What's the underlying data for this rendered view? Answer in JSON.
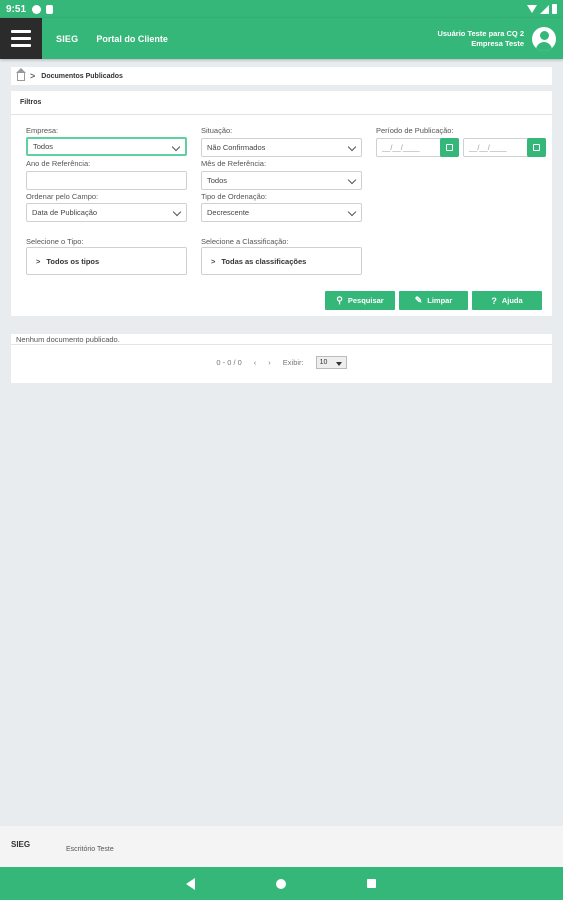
{
  "statusbar": {
    "time": "9:51"
  },
  "appbar": {
    "logo": "SIEG",
    "title": "Portal do Cliente",
    "user_name": "Usuário Teste para CQ 2",
    "company": "Empresa Teste"
  },
  "breadcrumb": {
    "current": "Documentos Publicados"
  },
  "filters": {
    "title": "Filtros",
    "empresa": {
      "label": "Empresa:",
      "value": "Todos"
    },
    "situacao": {
      "label": "Situação:",
      "value": "Não Confirmados"
    },
    "periodo": {
      "label": "Período de Publicação:",
      "start_placeholder": "__/__/____",
      "end_placeholder": "__/__/____"
    },
    "ano": {
      "label": "Ano de Referência:",
      "value": ""
    },
    "mes": {
      "label": "Mês de Referência:",
      "value": "Todos"
    },
    "ordenar": {
      "label": "Ordenar pelo Campo:",
      "value": "Data de Publicação"
    },
    "tipo_ordenacao": {
      "label": "Tipo de Ordenação:",
      "value": "Decrescente"
    },
    "tipo": {
      "label": "Selecione o Tipo:",
      "value": "Todos os tipos"
    },
    "classificacao": {
      "label": "Selecione a Classificação:",
      "value": "Todas as classificações"
    },
    "buttons": {
      "search": "Pesquisar",
      "clear": "Limpar",
      "help": "Ajuda"
    }
  },
  "results": {
    "empty_message": "Nenhum documento publicado.",
    "range": "0 - 0 / 0",
    "show_label": "Exibir:",
    "page_size": "10"
  },
  "footer": {
    "logo": "SIEG",
    "office": "Escritório Teste"
  },
  "colors": {
    "primary": "#36b77a",
    "menu": "#2b2b2b",
    "background": "#e9ecef"
  }
}
